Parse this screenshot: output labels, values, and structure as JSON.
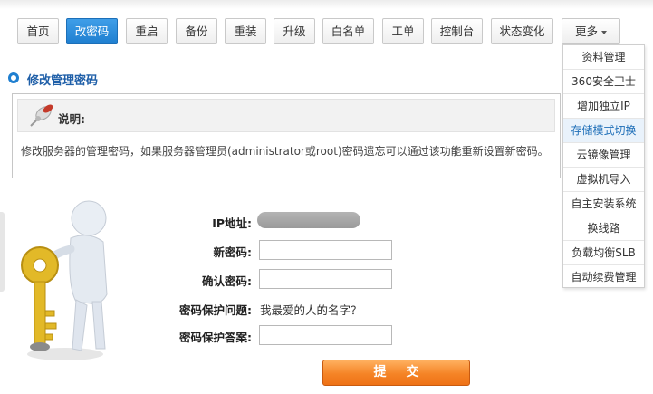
{
  "nav": {
    "items": [
      {
        "label": "首页"
      },
      {
        "label": "改密码",
        "active": true
      },
      {
        "label": "重启"
      },
      {
        "label": "备份"
      },
      {
        "label": "重装"
      },
      {
        "label": "升级"
      },
      {
        "label": "白名单"
      },
      {
        "label": "工单"
      },
      {
        "label": "控制台"
      },
      {
        "label": "状态变化"
      }
    ],
    "more_label": "更多"
  },
  "more_menu": {
    "items": [
      "资料管理",
      "360安全卫士",
      "增加独立IP",
      "存储模式切换",
      "云镜像管理",
      "虚拟机导入",
      "自主安装系统",
      "换线路",
      "负载均衡SLB",
      "自动续费管理"
    ],
    "highlighted_index": 3
  },
  "section": {
    "title": "修改管理密码"
  },
  "info": {
    "heading": "说明:",
    "text": "修改服务器的管理密码，如果服务器管理员(administrator或root)密码遗忘可以通过该功能重新设置新密码。"
  },
  "form": {
    "ip_label": "IP地址:",
    "new_password_label": "新密码:",
    "confirm_password_label": "确认密码:",
    "question_label": "密码保护问题:",
    "question_value": "我最爱的人的名字？",
    "answer_label": "密码保护答案:",
    "new_password_value": "",
    "confirm_password_value": "",
    "answer_value": ""
  },
  "submit_label": "提交",
  "colors": {
    "accent_blue": "#1f7fd0",
    "submit_orange": "#f58426",
    "key_gold": "#e2b928"
  }
}
